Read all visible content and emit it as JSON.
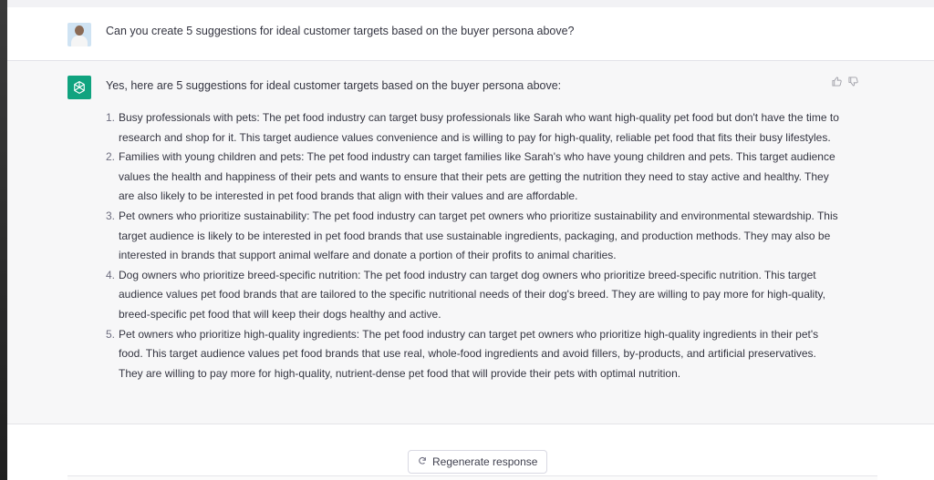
{
  "conversation": {
    "user_message": "Can you create 5 suggestions for ideal customer targets based on the buyer persona above?",
    "assistant_intro": "Yes, here are 5 suggestions for ideal customer targets based on the buyer persona above:",
    "suggestions": [
      {
        "num": "1.",
        "text": "Busy professionals with pets: The pet food industry can target busy professionals like Sarah who want high-quality pet food but don't have the time to research and shop for it. This target audience values convenience and is willing to pay for high-quality, reliable pet food that fits their busy lifestyles."
      },
      {
        "num": "2.",
        "text": "Families with young children and pets: The pet food industry can target families like Sarah's who have young children and pets. This target audience values the health and happiness of their pets and wants to ensure that their pets are getting the nutrition they need to stay active and healthy. They are also likely to be interested in pet food brands that align with their values and are affordable."
      },
      {
        "num": "3.",
        "text": "Pet owners who prioritize sustainability: The pet food industry can target pet owners who prioritize sustainability and environmental stewardship. This target audience is likely to be interested in pet food brands that use sustainable ingredients, packaging, and production methods. They may also be interested in brands that support animal welfare and donate a portion of their profits to animal charities."
      },
      {
        "num": "4.",
        "text": "Dog owners who prioritize breed-specific nutrition: The pet food industry can target dog owners who prioritize breed-specific nutrition. This target audience values pet food brands that are tailored to the specific nutritional needs of their dog's breed. They are willing to pay more for high-quality, breed-specific pet food that will keep their dogs healthy and active."
      },
      {
        "num": "5.",
        "text": "Pet owners who prioritize high-quality ingredients: The pet food industry can target pet owners who prioritize high-quality ingredients in their pet's food. This target audience values pet food brands that use real, whole-food ingredients and avoid fillers, by-products, and artificial preservatives. They are willing to pay more for high-quality, nutrient-dense pet food that will provide their pets with optimal nutrition."
      }
    ]
  },
  "controls": {
    "regenerate_label": "Regenerate response",
    "regenerate_icon": "refresh-icon",
    "thumbs_up_icon": "thumbs-up-icon",
    "thumbs_down_icon": "thumbs-down-icon"
  },
  "colors": {
    "accent": "#10a37f",
    "assistant_bg": "#f7f7f8",
    "text": "#343541"
  }
}
